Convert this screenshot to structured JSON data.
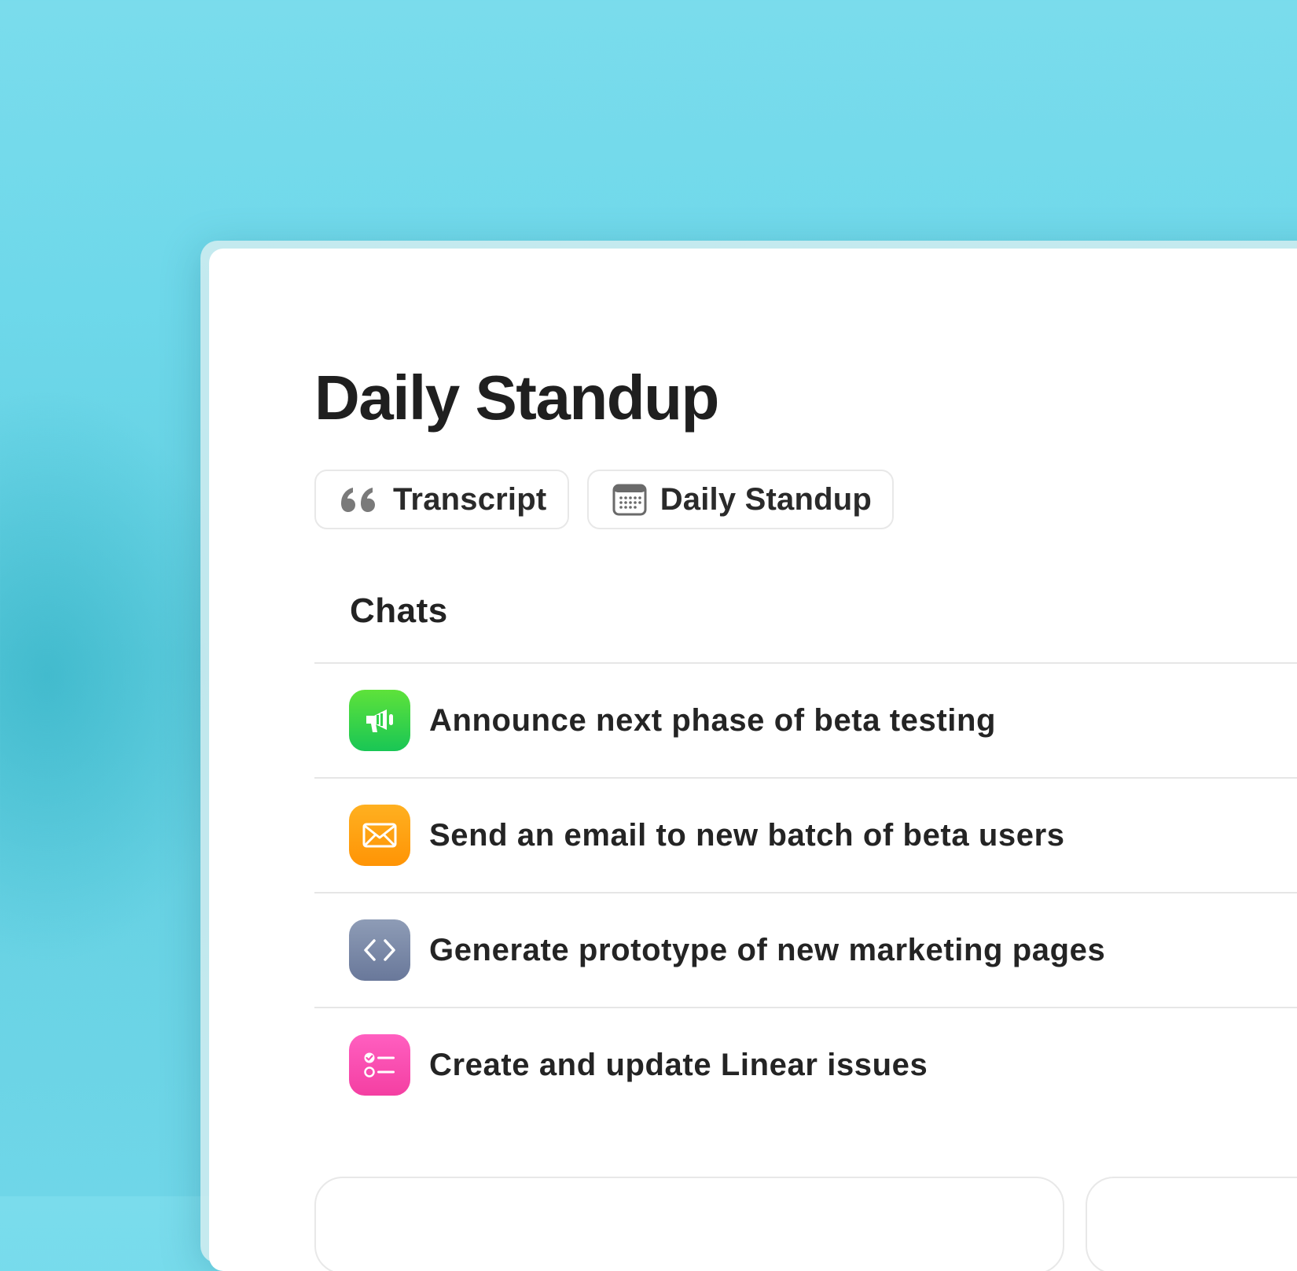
{
  "page": {
    "title": "Daily Standup"
  },
  "pills": [
    {
      "label": "Transcript",
      "icon": "quote-icon"
    },
    {
      "label": "Daily Standup",
      "icon": "calendar-icon"
    }
  ],
  "chats": {
    "title": "Chats",
    "items": [
      {
        "label": "Announce next phase of beta testing",
        "icon": "megaphone-icon",
        "color": "#2fd44a"
      },
      {
        "label": "Send an email to new batch of beta users",
        "icon": "mail-icon",
        "color": "#ffa10f"
      },
      {
        "label": "Generate prototype of new marketing pages",
        "icon": "code-icon",
        "color": "#7b89a8"
      },
      {
        "label": "Create and update Linear issues",
        "icon": "checklist-icon",
        "color": "#f94eb1"
      }
    ]
  },
  "colors": {
    "background": "#6ed8ea",
    "card": "#ffffff",
    "text": "#1f1f1f"
  }
}
